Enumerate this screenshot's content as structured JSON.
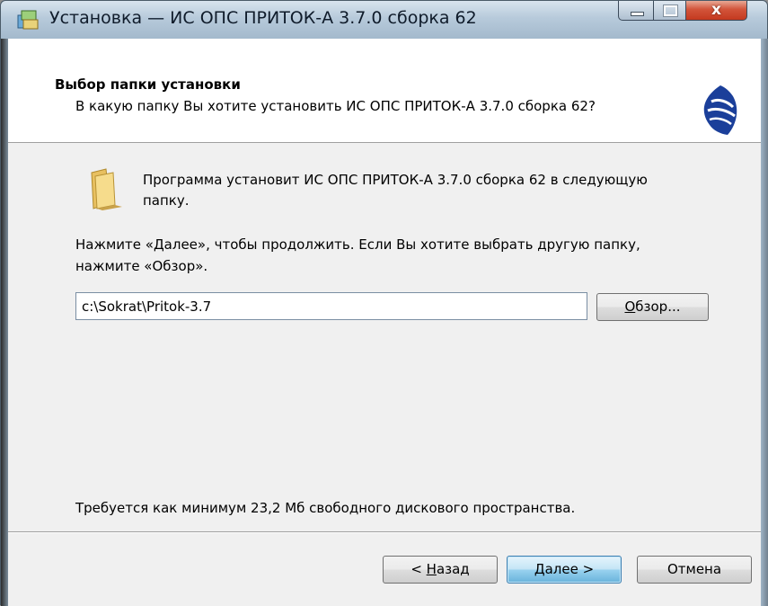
{
  "window": {
    "title": "Установка — ИС ОПС ПРИТОК-А 3.7.0 сборка 62",
    "controls": {
      "minimize": "",
      "maximize": "",
      "close": "x"
    }
  },
  "header": {
    "title": "Выбор папки установки",
    "subtitle": "В какую папку Вы хотите установить ИС ОПС ПРИТОК-А 3.7.0 сборка 62?"
  },
  "body": {
    "info_line1": "Программа установит ИС ОПС ПРИТОК-А 3.7.0 сборка 62 в следующую",
    "info_line2": "папку.",
    "hint_line1": "Нажмите «Далее», чтобы продолжить. Если Вы хотите выбрать другую папку,",
    "hint_line2": "нажмите «Обзор».",
    "path_value": "c:\\Sokrat\\Pritok-3.7",
    "browse_hotkey": "О",
    "browse_rest": "бзор...",
    "requirement": "Требуется как минимум 23,2 Мб свободного дискового пространства."
  },
  "footer": {
    "back_prefix": "< ",
    "back_hotkey": "Н",
    "back_rest": "азад",
    "next_label": "Далее >",
    "cancel_label": "Отмена"
  },
  "colors": {
    "title_bar": "#b7cadb",
    "close_button": "#c4391f",
    "panel": "#f0f0f0",
    "default_button": "#98d1ef"
  },
  "icons": {
    "title": "installer-package-icon",
    "logo": "pritok-logo",
    "folder": "folder-icon"
  }
}
